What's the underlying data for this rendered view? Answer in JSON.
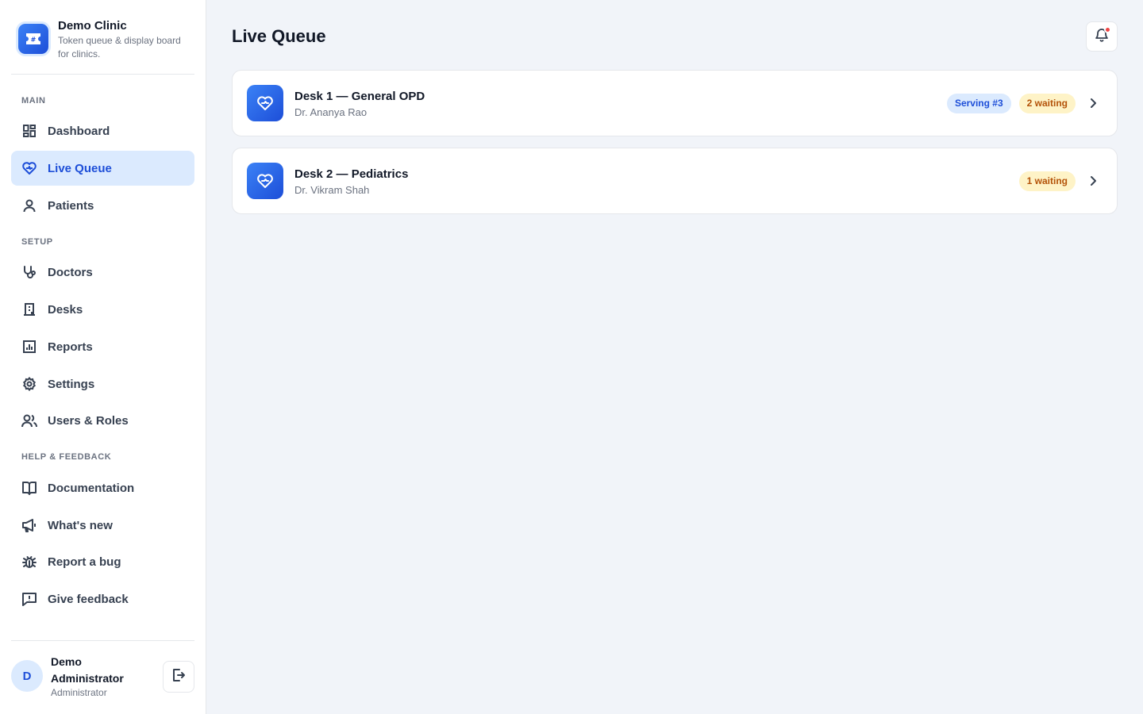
{
  "brand": {
    "title": "Demo Clinic",
    "subtitle": "Token queue & display board for clinics."
  },
  "sidebar": {
    "sections": {
      "main": "MAIN",
      "setup": "SETUP",
      "help": "HELP & FEEDBACK"
    },
    "items": [
      {
        "label": "Dashboard",
        "icon": "dashboard-icon"
      },
      {
        "label": "Live Queue",
        "icon": "heart-pulse-icon",
        "active": true
      },
      {
        "label": "Patients",
        "icon": "user-icon"
      },
      {
        "label": "Doctors",
        "icon": "stethoscope-icon"
      },
      {
        "label": "Desks",
        "icon": "building-icon"
      },
      {
        "label": "Reports",
        "icon": "bar-chart-icon"
      },
      {
        "label": "Settings",
        "icon": "gear-icon"
      },
      {
        "label": "Users & Roles",
        "icon": "users-icon"
      },
      {
        "label": "Documentation",
        "icon": "book-icon"
      },
      {
        "label": "What's new",
        "icon": "megaphone-icon"
      },
      {
        "label": "Report a bug",
        "icon": "bug-icon"
      },
      {
        "label": "Give feedback",
        "icon": "message-icon"
      }
    ]
  },
  "user": {
    "initial": "D",
    "name": "Demo Administrator",
    "role": "Administrator"
  },
  "main": {
    "title": "Live Queue",
    "desks": [
      {
        "name": "Desk 1 — General OPD",
        "doctor": "Dr. Ananya Rao",
        "serving": "Serving #3",
        "waiting": "2 waiting"
      },
      {
        "name": "Desk 2 — Pediatrics",
        "doctor": "Dr. Vikram Shah",
        "serving": "",
        "waiting": "1 waiting"
      }
    ]
  },
  "colors": {
    "accent": "#1d4ed8",
    "accent_light": "#dbeafe",
    "waiting_bg": "#fef3c7",
    "waiting_fg": "#b45309",
    "notification": "#ef4444"
  }
}
